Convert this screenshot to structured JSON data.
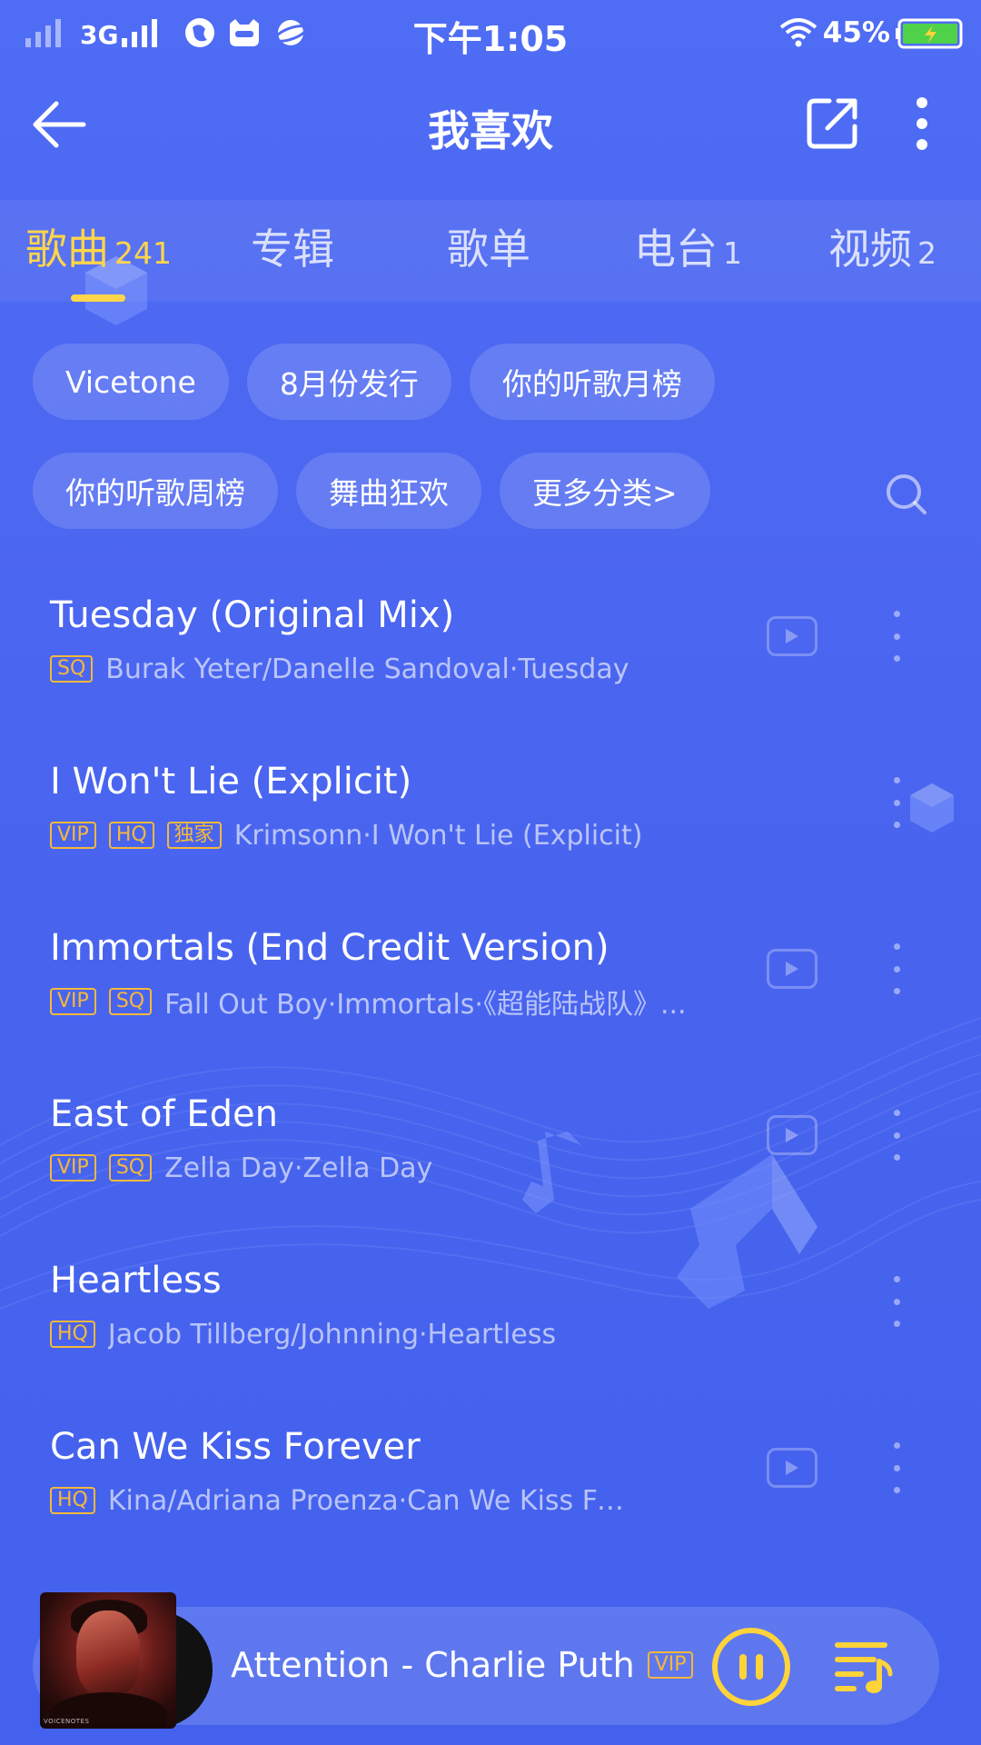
{
  "status_bar": {
    "network": "3G",
    "time": "下午1:05",
    "battery": "45%"
  },
  "header": {
    "title": "我喜欢"
  },
  "tabs": [
    {
      "label": "歌曲",
      "count": "241",
      "active": true
    },
    {
      "label": "专辑",
      "count": ""
    },
    {
      "label": "歌单",
      "count": ""
    },
    {
      "label": "电台",
      "count": "1"
    },
    {
      "label": "视频",
      "count": "2"
    }
  ],
  "chips_row1": [
    "Vicetone",
    "8月份发行",
    "你的听歌月榜"
  ],
  "chips_row2": [
    "你的听歌周榜",
    "舞曲狂欢",
    "更多分类>"
  ],
  "songs": [
    {
      "title": "Tuesday (Original Mix)",
      "badges": [
        "SQ"
      ],
      "meta": "Burak Yeter/Danelle Sandoval·Tuesday",
      "has_mv": true
    },
    {
      "title": "I Won't Lie (Explicit)",
      "badges": [
        "VIP",
        "HQ",
        "独家"
      ],
      "meta": "Krimsonn·I Won't Lie (Explicit)",
      "has_mv": false
    },
    {
      "title": "Immortals (End Credit Version)",
      "badges": [
        "VIP",
        "SQ"
      ],
      "meta": "Fall Out Boy·Immortals·《超能陆战队》...",
      "has_mv": true
    },
    {
      "title": "East of Eden",
      "badges": [
        "VIP",
        "SQ"
      ],
      "meta": "Zella Day·Zella Day",
      "has_mv": true
    },
    {
      "title": "Heartless",
      "badges": [
        "HQ"
      ],
      "meta": "Jacob Tillberg/Johnning·Heartless",
      "has_mv": false
    },
    {
      "title": "Can We Kiss Forever",
      "badges": [
        "HQ"
      ],
      "meta": "Kina/Adriana Proenza·Can We Kiss Forever?",
      "has_mv": true
    }
  ],
  "player": {
    "song": "Attention - Charlie Puth",
    "badge": "VIP",
    "cover_text": "VOICENOTES"
  },
  "colors": {
    "background": "#4b66f0",
    "accent": "#ffd54a",
    "badge": "#f5b83a"
  }
}
